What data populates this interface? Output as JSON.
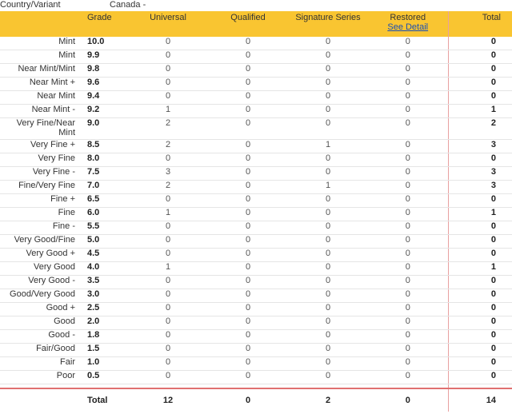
{
  "country_label": "Country/Variant",
  "country_value": "Canada -",
  "columns": {
    "grade": "Grade",
    "universal": "Universal",
    "qualified": "Qualified",
    "signature": "Signature Series",
    "restored": "Restored",
    "restored_link": "See Detail",
    "total": "Total"
  },
  "rows": [
    {
      "name": "Mint",
      "grade": "10.0",
      "universal": "0",
      "qualified": "0",
      "signature": "0",
      "restored": "0",
      "total": "0"
    },
    {
      "name": "Mint",
      "grade": "9.9",
      "universal": "0",
      "qualified": "0",
      "signature": "0",
      "restored": "0",
      "total": "0"
    },
    {
      "name": "Near Mint/Mint",
      "grade": "9.8",
      "universal": "0",
      "qualified": "0",
      "signature": "0",
      "restored": "0",
      "total": "0"
    },
    {
      "name": "Near Mint +",
      "grade": "9.6",
      "universal": "0",
      "qualified": "0",
      "signature": "0",
      "restored": "0",
      "total": "0"
    },
    {
      "name": "Near Mint",
      "grade": "9.4",
      "universal": "0",
      "qualified": "0",
      "signature": "0",
      "restored": "0",
      "total": "0"
    },
    {
      "name": "Near Mint -",
      "grade": "9.2",
      "universal": "1",
      "qualified": "0",
      "signature": "0",
      "restored": "0",
      "total": "1"
    },
    {
      "name": "Very Fine/Near Mint",
      "grade": "9.0",
      "universal": "2",
      "qualified": "0",
      "signature": "0",
      "restored": "0",
      "total": "2"
    },
    {
      "name": "Very Fine +",
      "grade": "8.5",
      "universal": "2",
      "qualified": "0",
      "signature": "1",
      "restored": "0",
      "total": "3"
    },
    {
      "name": "Very Fine",
      "grade": "8.0",
      "universal": "0",
      "qualified": "0",
      "signature": "0",
      "restored": "0",
      "total": "0"
    },
    {
      "name": "Very Fine -",
      "grade": "7.5",
      "universal": "3",
      "qualified": "0",
      "signature": "0",
      "restored": "0",
      "total": "3"
    },
    {
      "name": "Fine/Very Fine",
      "grade": "7.0",
      "universal": "2",
      "qualified": "0",
      "signature": "1",
      "restored": "0",
      "total": "3"
    },
    {
      "name": "Fine +",
      "grade": "6.5",
      "universal": "0",
      "qualified": "0",
      "signature": "0",
      "restored": "0",
      "total": "0"
    },
    {
      "name": "Fine",
      "grade": "6.0",
      "universal": "1",
      "qualified": "0",
      "signature": "0",
      "restored": "0",
      "total": "1"
    },
    {
      "name": "Fine -",
      "grade": "5.5",
      "universal": "0",
      "qualified": "0",
      "signature": "0",
      "restored": "0",
      "total": "0"
    },
    {
      "name": "Very Good/Fine",
      "grade": "5.0",
      "universal": "0",
      "qualified": "0",
      "signature": "0",
      "restored": "0",
      "total": "0"
    },
    {
      "name": "Very Good +",
      "grade": "4.5",
      "universal": "0",
      "qualified": "0",
      "signature": "0",
      "restored": "0",
      "total": "0"
    },
    {
      "name": "Very Good",
      "grade": "4.0",
      "universal": "1",
      "qualified": "0",
      "signature": "0",
      "restored": "0",
      "total": "1"
    },
    {
      "name": "Very Good -",
      "grade": "3.5",
      "universal": "0",
      "qualified": "0",
      "signature": "0",
      "restored": "0",
      "total": "0"
    },
    {
      "name": "Good/Very Good",
      "grade": "3.0",
      "universal": "0",
      "qualified": "0",
      "signature": "0",
      "restored": "0",
      "total": "0"
    },
    {
      "name": "Good +",
      "grade": "2.5",
      "universal": "0",
      "qualified": "0",
      "signature": "0",
      "restored": "0",
      "total": "0"
    },
    {
      "name": "Good",
      "grade": "2.0",
      "universal": "0",
      "qualified": "0",
      "signature": "0",
      "restored": "0",
      "total": "0"
    },
    {
      "name": "Good -",
      "grade": "1.8",
      "universal": "0",
      "qualified": "0",
      "signature": "0",
      "restored": "0",
      "total": "0"
    },
    {
      "name": "Fair/Good",
      "grade": "1.5",
      "universal": "0",
      "qualified": "0",
      "signature": "0",
      "restored": "0",
      "total": "0"
    },
    {
      "name": "Fair",
      "grade": "1.0",
      "universal": "0",
      "qualified": "0",
      "signature": "0",
      "restored": "0",
      "total": "0"
    },
    {
      "name": "Poor",
      "grade": "0.5",
      "universal": "0",
      "qualified": "0",
      "signature": "0",
      "restored": "0",
      "total": "0"
    }
  ],
  "totals": {
    "label": "Total",
    "universal": "12",
    "qualified": "0",
    "signature": "2",
    "restored": "0",
    "total": "14"
  },
  "colors": {
    "header_bg": "#f9c531",
    "link": "#1a4fb5",
    "divider": "#e07070"
  }
}
